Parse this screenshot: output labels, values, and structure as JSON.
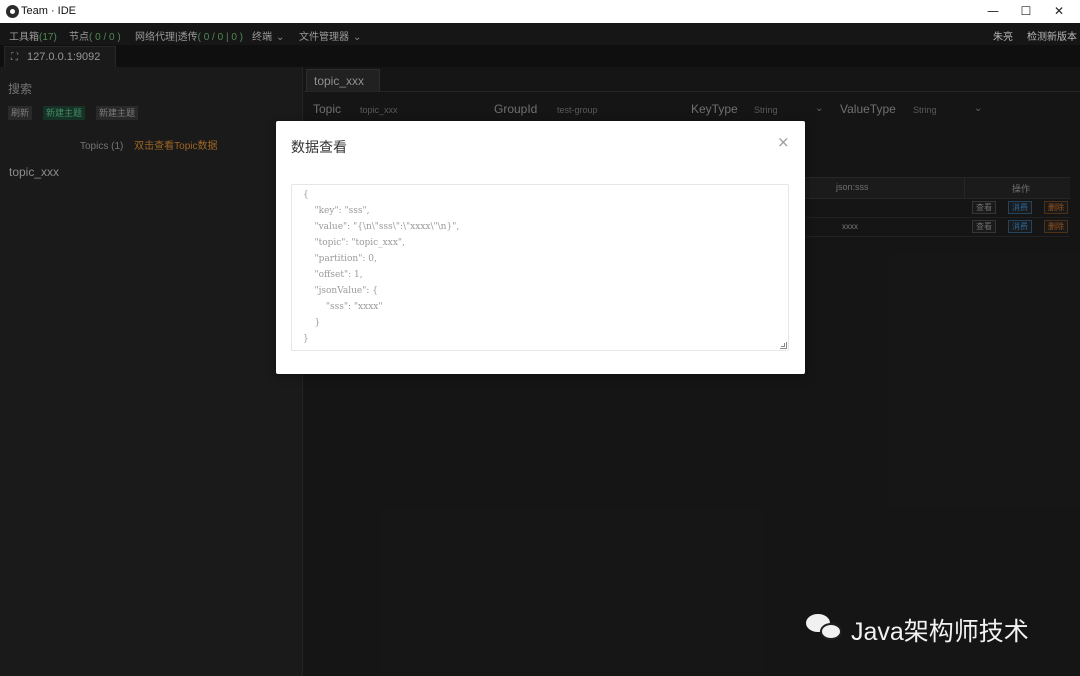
{
  "window": {
    "title": "Team · IDE",
    "controls": {
      "minimize": "—",
      "maximize": "☐",
      "close": "✕"
    }
  },
  "menubar": {
    "toolbox_label": "工具箱",
    "toolbox_count": "(17)",
    "nodes_label": "节点",
    "nodes_count": "( 0 / 0 )",
    "proxy_label": "网络代理|透传",
    "proxy_count": "( 0 / 0 | 0 )",
    "terminal_label": "终端",
    "file_manager_label": "文件管理器",
    "user_name": "朱亮",
    "check_update_label": "检测新版本"
  },
  "connection_tab": {
    "label": "127.0.0.1:9092",
    "icon": "network-icon"
  },
  "sidebar": {
    "search_label": "搜索",
    "buttons": {
      "refresh": "刷新",
      "new_topic_1": "新建主题",
      "new_topic_2": "新建主题"
    },
    "topics_label": "Topics",
    "topics_count": "(1)",
    "topics_hint": "双击查看Topic数据",
    "topic_items": [
      "topic_xxx"
    ]
  },
  "main": {
    "tab_label": "topic_xxx",
    "form": {
      "topic_label": "Topic",
      "topic_value": "topic_xxx",
      "group_label": "GroupId",
      "group_value": "test-group",
      "keytype_label": "KeyType",
      "keytype_value": "String",
      "valuetype_label": "ValueType",
      "valuetype_value": "String"
    },
    "grid": {
      "col_json": "json:sss",
      "col_ops": "操作",
      "rows": [
        {
          "json_value": ""
        },
        {
          "json_value": "xxxx"
        }
      ],
      "row_buttons": {
        "view": "查看",
        "consume": "消费",
        "delete": "删除"
      }
    }
  },
  "modal": {
    "title": "数据查看",
    "close_icon": "×",
    "json_lines": [
      "{",
      "    \"key\": \"sss\",",
      "    \"value\": \"{\\n\\\"sss\\\":\\\"xxxx\\\"\\n}\",",
      "    \"topic\": \"topic_xxx\",",
      "    \"partition\": 0,",
      "    \"offset\": 1,",
      "    \"jsonValue\": {",
      "        \"sss\": \"xxxx\"",
      "    }",
      "}"
    ]
  },
  "watermark": {
    "text": "Java架构师技术"
  }
}
